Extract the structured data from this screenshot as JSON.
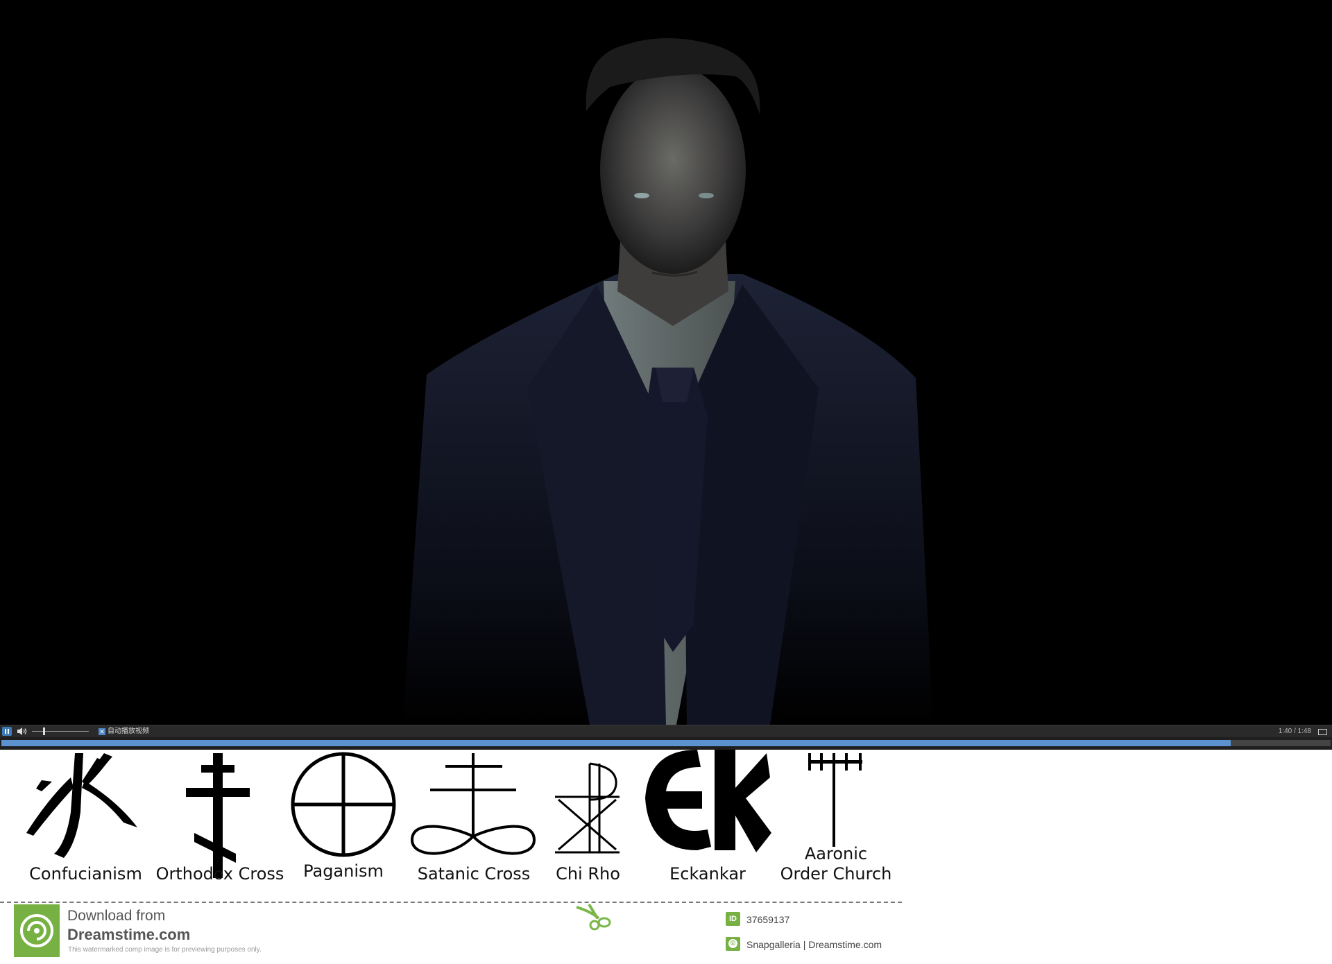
{
  "player": {
    "autoplay_label": "自动播放视频",
    "time": "1:40 / 1:48",
    "progress_fraction": 0.925,
    "volume_fraction": 0.2,
    "accent_color": "#5b92cf"
  },
  "symbols": [
    {
      "id": "confucianism",
      "label": "Confucianism"
    },
    {
      "id": "orthodox-cross",
      "label": "Orthodox Cross"
    },
    {
      "id": "paganism",
      "label": "Paganism"
    },
    {
      "id": "satanic-cross",
      "label": "Satanic Cross"
    },
    {
      "id": "chi-rho",
      "label": "Chi Rho"
    },
    {
      "id": "eckankar",
      "label": "Eckankar"
    },
    {
      "id": "aaronic",
      "label_line1": "Aaronic",
      "label_line2": "Order Church"
    }
  ],
  "footer": {
    "download_from": "Download from",
    "site": "Dreamstime.com",
    "note": "This watermarked comp image is for previewing purposes only.",
    "id_badge": "ID",
    "image_id": "37659137",
    "credit": "Snapgalleria | Dreamstime.com",
    "brand_color": "#77b043"
  }
}
